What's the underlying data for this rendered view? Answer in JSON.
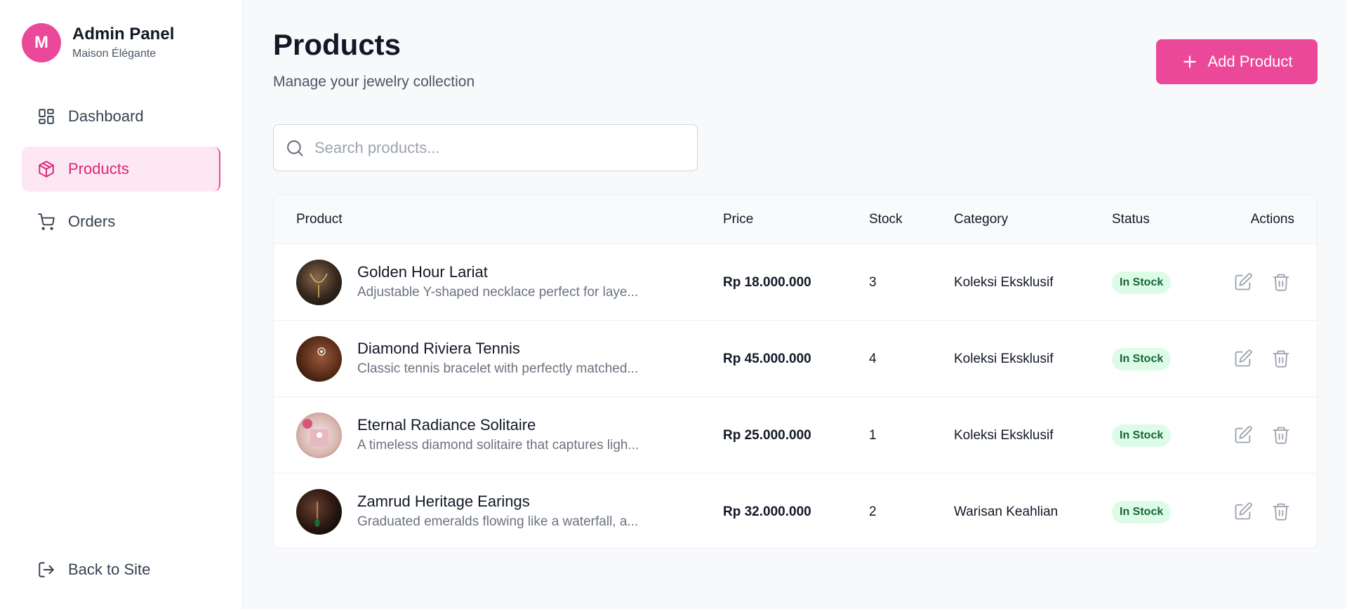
{
  "brand": {
    "avatar_letter": "M",
    "title": "Admin Panel",
    "subtitle": "Maison Élégante"
  },
  "sidebar": {
    "items": [
      {
        "label": "Dashboard",
        "icon": "dashboard-icon",
        "active": false
      },
      {
        "label": "Products",
        "icon": "package-icon",
        "active": true
      },
      {
        "label": "Orders",
        "icon": "cart-icon",
        "active": false
      }
    ],
    "back_label": "Back to Site"
  },
  "header": {
    "title": "Products",
    "subtitle": "Manage your jewelry collection",
    "add_label": "Add Product"
  },
  "search": {
    "placeholder": "Search products...",
    "value": ""
  },
  "table": {
    "columns": [
      "Product",
      "Price",
      "Stock",
      "Category",
      "Status",
      "Actions"
    ],
    "rows": [
      {
        "name": "Golden Hour Lariat",
        "description": "Adjustable Y-shaped necklace perfect for laye...",
        "price": "Rp 18.000.000",
        "stock": "3",
        "category": "Koleksi Eksklusif",
        "status": "In Stock"
      },
      {
        "name": "Diamond Riviera Tennis",
        "description": "Classic tennis bracelet with perfectly matched...",
        "price": "Rp 45.000.000",
        "stock": "4",
        "category": "Koleksi Eksklusif",
        "status": "In Stock"
      },
      {
        "name": "Eternal Radiance Solitaire",
        "description": "A timeless diamond solitaire that captures ligh...",
        "price": "Rp 25.000.000",
        "stock": "1",
        "category": "Koleksi Eksklusif",
        "status": "In Stock"
      },
      {
        "name": "Zamrud Heritage Earings",
        "description": "Graduated emeralds flowing like a waterfall, a...",
        "price": "Rp 32.000.000",
        "stock": "2",
        "category": "Warisan Keahlian",
        "status": "In Stock"
      }
    ]
  },
  "colors": {
    "accent": "#ec4899",
    "accent_soft": "#fce7f3",
    "status_bg": "#dcfce7",
    "status_text": "#166534"
  }
}
